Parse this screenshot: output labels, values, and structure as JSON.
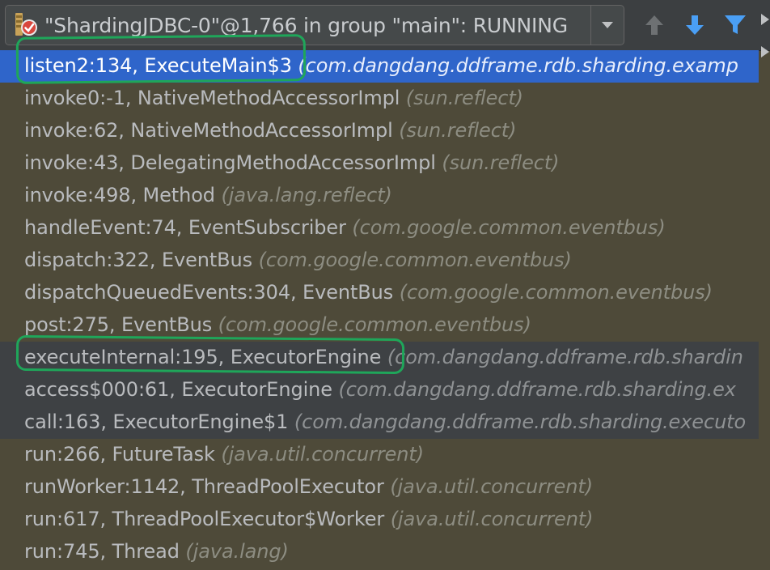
{
  "thread_selector": {
    "label": "\"ShardingJDBC-0\"@1,766 in group \"main\": RUNNING",
    "status_icon": "thread-suspended-icon"
  },
  "toolbar": {
    "icons": [
      "arrow-up-icon",
      "arrow-down-icon",
      "filter-icon"
    ],
    "colors": {
      "up": "#6e7173",
      "down": "#4a9ff5",
      "filter": "#4a9ff5"
    }
  },
  "frames": [
    {
      "method": "listen2:134, ExecuteMain$3",
      "package": "(com.dangdang.ddframe.rdb.sharding.examp",
      "state": "selected"
    },
    {
      "method": "invoke0:-1, NativeMethodAccessorImpl",
      "package": "(sun.reflect)",
      "state": "normal"
    },
    {
      "method": "invoke:62, NativeMethodAccessorImpl",
      "package": "(sun.reflect)",
      "state": "normal"
    },
    {
      "method": "invoke:43, DelegatingMethodAccessorImpl",
      "package": "(sun.reflect)",
      "state": "normal"
    },
    {
      "method": "invoke:498, Method",
      "package": "(java.lang.reflect)",
      "state": "normal"
    },
    {
      "method": "handleEvent:74, EventSubscriber",
      "package": "(com.google.common.eventbus)",
      "state": "normal"
    },
    {
      "method": "dispatch:322, EventBus",
      "package": "(com.google.common.eventbus)",
      "state": "normal"
    },
    {
      "method": "dispatchQueuedEvents:304, EventBus",
      "package": "(com.google.common.eventbus)",
      "state": "normal"
    },
    {
      "method": "post:275, EventBus",
      "package": "(com.google.common.eventbus)",
      "state": "normal"
    },
    {
      "method": "executeInternal:195, ExecutorEngine",
      "package": "(com.dangdang.ddframe.rdb.shardin",
      "state": "async"
    },
    {
      "method": "access$000:61, ExecutorEngine",
      "package": "(com.dangdang.ddframe.rdb.sharding.ex",
      "state": "async"
    },
    {
      "method": "call:163, ExecutorEngine$1",
      "package": "(com.dangdang.ddframe.rdb.sharding.executo",
      "state": "async"
    },
    {
      "method": "run:266, FutureTask",
      "package": "(java.util.concurrent)",
      "state": "normal"
    },
    {
      "method": "runWorker:1142, ThreadPoolExecutor",
      "package": "(java.util.concurrent)",
      "state": "normal"
    },
    {
      "method": "run:617, ThreadPoolExecutor$Worker",
      "package": "(java.util.concurrent)",
      "state": "normal"
    },
    {
      "method": "run:745, Thread",
      "package": "(java.lang)",
      "state": "normal"
    }
  ],
  "colors": {
    "background": "#4e4a39",
    "selected": "#2f65ca",
    "async_block": "#3e4144",
    "annotation": "#1fa65a"
  }
}
